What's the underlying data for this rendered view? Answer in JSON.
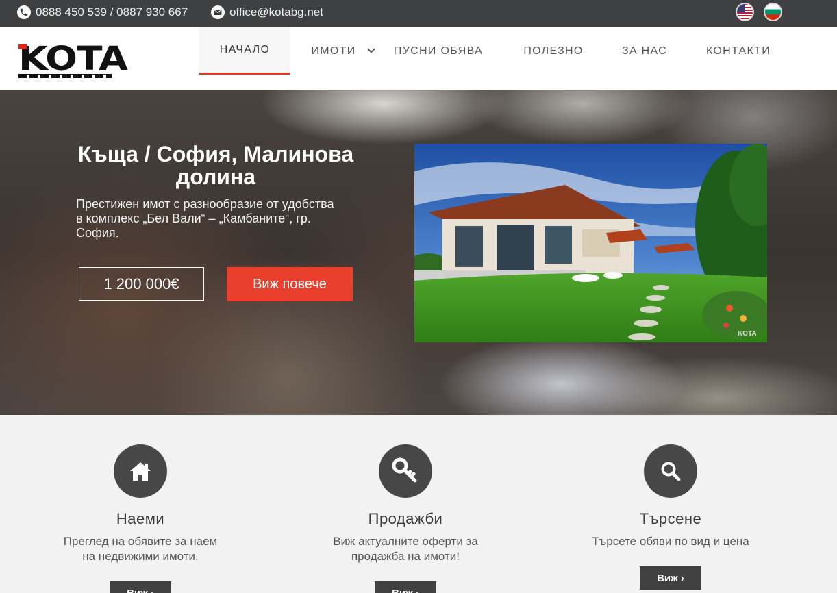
{
  "topbar": {
    "phone": "0888 450 539 / 0887 930 667",
    "email": "office@kotabg.net",
    "icons": {
      "phone": "phone-icon",
      "mail": "mail-icon"
    },
    "languages": [
      "en-flag-icon",
      "bg-flag-icon"
    ]
  },
  "header": {
    "logo_text": "KOTA",
    "nav": [
      {
        "label": "НАЧАЛО",
        "active": true
      },
      {
        "label": "ИМОТИ",
        "dropdown": true
      },
      {
        "label": "ПУСНИ ОБЯВА"
      },
      {
        "label": "ПОЛЕЗНО"
      },
      {
        "label": "ЗА НАС"
      },
      {
        "label": "КОНТАКТИ"
      }
    ]
  },
  "hero": {
    "title": "Къща / София, Малинова долина",
    "description": "Престижен имот с разнообразие от удобства в комплекс „Бел Вали“ – „Камбаните“, гр. София.",
    "price": "1 200 000€",
    "cta": "Виж повече",
    "photo_watermark": "KOTA"
  },
  "services": [
    {
      "icon": "home-icon",
      "title": "Наеми",
      "text": "Преглед на обявите за наем на недвижими имоти.",
      "button": "Виж ›"
    },
    {
      "icon": "key-icon",
      "title": "Продажби",
      "text": "Виж актуалните оферти за продажба на имоти!",
      "button": "Виж ›"
    },
    {
      "icon": "search-icon",
      "title": "Търсене",
      "text": "Търсете обяви по вид и цена",
      "button": "Виж ›"
    }
  ],
  "colors": {
    "accent": "#e8402c",
    "topbar": "#3f4042",
    "dark": "#414141"
  }
}
